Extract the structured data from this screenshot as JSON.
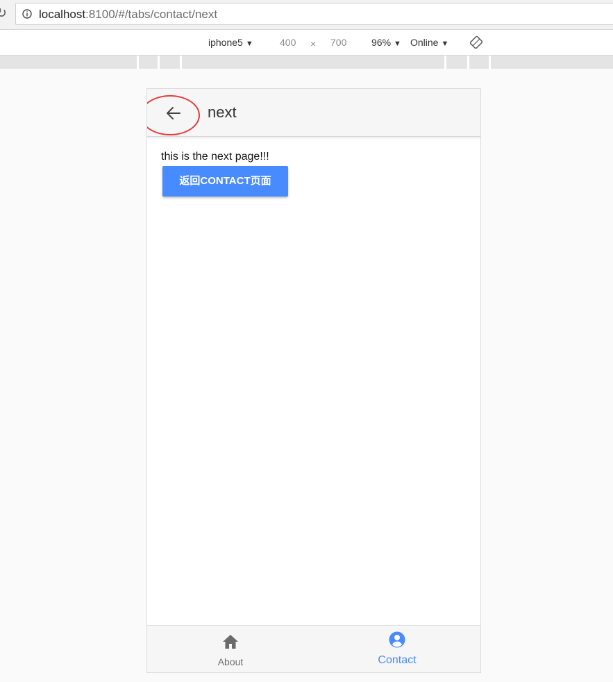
{
  "browser": {
    "url_host": "localhost",
    "url_path": ":8100/#/tabs/contact/next",
    "icons": {
      "reload": "reload-icon",
      "info": "info-icon"
    }
  },
  "device_toolbar": {
    "device": "iphone5",
    "width": "400",
    "separator": "×",
    "height": "700",
    "zoom": "96%",
    "network": "Online",
    "caret": "▼",
    "rotate_icon": "rotate-icon"
  },
  "app": {
    "title": "next",
    "back_icon": "arrow-back-icon",
    "content_text": "this is the next page!!!",
    "button_label": "返回CONTACT页面",
    "annotation_color": "#e53b3b"
  },
  "tabs": [
    {
      "label": "About",
      "icon": "home-icon",
      "selected": false
    },
    {
      "label": "Contact",
      "icon": "person-circle-icon",
      "selected": true
    }
  ],
  "colors": {
    "primary": "#488aff",
    "tab_inactive": "#707070",
    "toolbar_bg": "#f6f6f6"
  }
}
